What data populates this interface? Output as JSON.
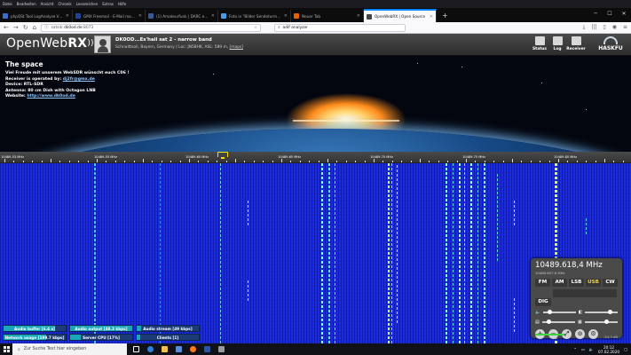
{
  "browser": {
    "menu": [
      "Datei",
      "Bearbeiten",
      "Ansicht",
      "Chronik",
      "Lesezeichen",
      "Extras",
      "Hilfe"
    ],
    "tabs": [
      {
        "title": "phpQSt Tool LogAnalyse Version 3",
        "color": "#3d6fc9"
      },
      {
        "title": "GMX Freemail - E-Mail made in",
        "color": "#1c449b"
      },
      {
        "title": "(1) Amateurfunk | DARC e.V.",
        "color": "#3b5998"
      },
      {
        "title": "Foto in \"Bilder Sendeturm Sch",
        "color": "#4b9ce8"
      },
      {
        "title": "Neuer Tab",
        "color": "#e66000"
      },
      {
        "title": "OpenWebRX | Open Source",
        "color": "#444444"
      }
    ],
    "new_tab": "+",
    "url_prefix": "satsdr.",
    "url_host": "dk0od.de",
    "url_port": ":8073",
    "search_value": "adif analyzer"
  },
  "header": {
    "logo_text_1": "OpenWeb",
    "logo_text_2": "RX",
    "title": "DK0OD...Es'hail sat 2 - narrow band",
    "location_text": "Schnaittsoll, Bayern, Germany | Loc: JN58HK, ASL: 589 m, ",
    "map_link": "[maps]",
    "buttons": [
      "Status",
      "Log",
      "Receiver"
    ],
    "sponsor": "HASKFU"
  },
  "description": {
    "heading": "The space",
    "greeting": "Viel Freude mit unserem WebSDR wünscht euch C06 !",
    "operator_label": "Receiver is operated by: ",
    "operator_email": "dj2fr@gmx.de",
    "device": "Device: RTL-SDR",
    "antenna": "Antenna: 80 cm Dish with Octagon LNB",
    "website_label": "Website: ",
    "website_url": "http://www.dk0od.de"
  },
  "scale_labels": [
    "10489.53 MHz",
    "10489.55 MHz",
    "10489.60 MHz",
    "10489.65 MHz",
    "10489.70 MHz",
    "10489.75 MHz",
    "10489.80 MHz"
  ],
  "status": {
    "audio_buffer": {
      "label": "Audio buffer [6.4 s]",
      "level": 0.83
    },
    "audio_output": {
      "label": "Audio output [48.3 kbps]",
      "level": 1.0
    },
    "audio_stream": {
      "label": "Audio stream [49 kbps]",
      "level": 0.07
    },
    "network": {
      "label": "Network usage [199.7 kbps]",
      "level": 0.68
    },
    "server_cpu": {
      "label": "Server CPU [17%]",
      "level": 0.17
    },
    "clients": {
      "label": "Clients [1]",
      "level": 0.05
    }
  },
  "receiver": {
    "frequency": "10489.618,4 MHz",
    "sub_frequency": "10489.607,6 MHz",
    "modes": [
      "FM",
      "AM",
      "LSB",
      "USB",
      "CW"
    ],
    "active_mode": "USB",
    "dig_label": "DIG",
    "smeter": "-54.3 dB"
  },
  "taskbar": {
    "search_placeholder": "Zur Suche Text hier eingeben",
    "time": "20:12",
    "date": "07.02.2020"
  }
}
